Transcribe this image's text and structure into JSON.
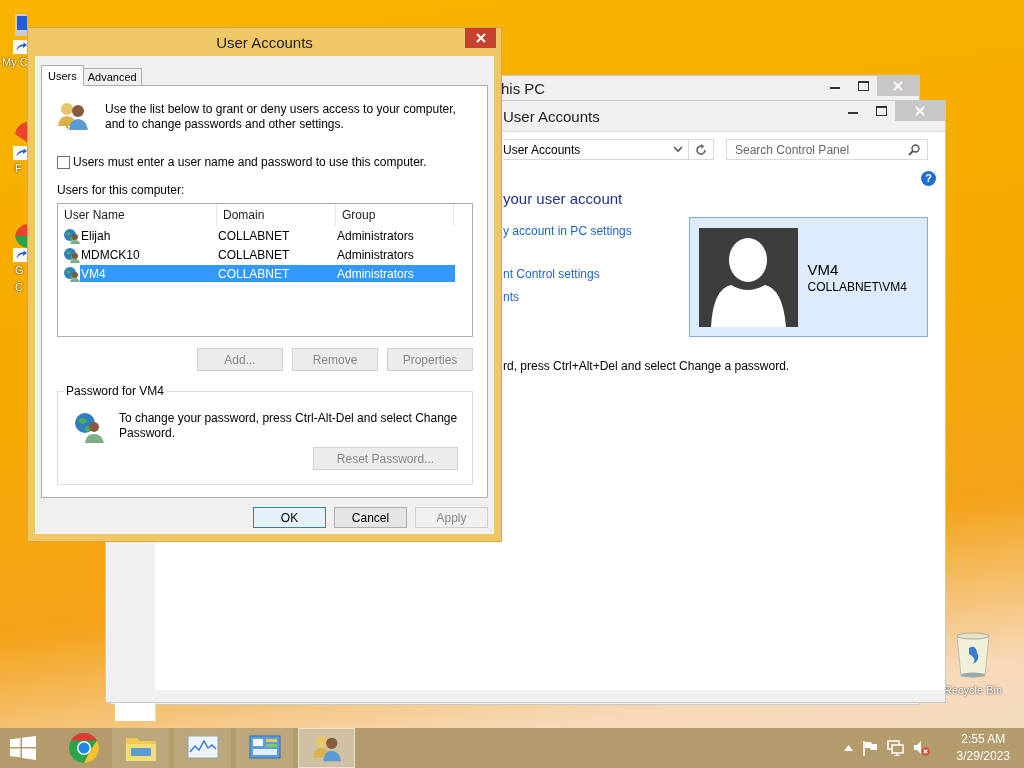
{
  "desktop": {
    "icons": [
      {
        "label": "My C",
        "kind": "computer"
      },
      {
        "label": "F",
        "kind": "red"
      },
      {
        "label": "G C",
        "kind": "green"
      }
    ],
    "recycle_bin": {
      "label": "Recycle Bin"
    }
  },
  "this_pc_window": {
    "title": "his PC"
  },
  "control_panel_window": {
    "title": "User Accounts",
    "address": "User Accounts",
    "search": {
      "placeholder": "Search Control Panel"
    },
    "help": "?",
    "heading": "your user account",
    "links": [
      "y account in PC settings",
      "nt Control settings",
      "nts"
    ],
    "account_card": {
      "name": "VM4",
      "account": "COLLABNET\\VM4"
    },
    "note": "rd, press Ctrl+Alt+Del and select Change a password."
  },
  "dialog": {
    "title": "User Accounts",
    "tabs": [
      {
        "label": "Users",
        "selected": true
      },
      {
        "label": "Advanced",
        "selected": false
      }
    ],
    "intro": "Use the list below to grant or deny users access to your computer, and to change passwords and other settings.",
    "require_password": {
      "label": "Users must enter a user name and password to use this computer.",
      "checked": false
    },
    "list_label": "Users for this computer:",
    "columns": [
      "User Name",
      "Domain",
      "Group"
    ],
    "rows": [
      {
        "user_name": "Elijah",
        "domain": "COLLABNET",
        "group": "Administrators",
        "selected": false
      },
      {
        "user_name": "MDMCK10",
        "domain": "COLLABNET",
        "group": "Administrators",
        "selected": false
      },
      {
        "user_name": "VM4",
        "domain": "COLLABNET",
        "group": "Administrators",
        "selected": true
      }
    ],
    "list_buttons": [
      {
        "label": "Add...",
        "disabled": true
      },
      {
        "label": "Remove",
        "disabled": true
      },
      {
        "label": "Properties",
        "disabled": true
      }
    ],
    "password_group": {
      "title": "Password for VM4",
      "text": "To change your password, press Ctrl-Alt-Del and select Change Password.",
      "button": {
        "label": "Reset Password...",
        "disabled": true
      }
    },
    "buttons": [
      {
        "label": "OK",
        "disabled": false
      },
      {
        "label": "Cancel",
        "disabled": false
      },
      {
        "label": "Apply",
        "disabled": true
      }
    ]
  },
  "taskbar": {
    "items": [
      {
        "kind": "start",
        "selected": false
      },
      {
        "kind": "browser",
        "selected": false
      },
      {
        "kind": "folder",
        "selected": false
      },
      {
        "kind": "monitor",
        "selected": false
      },
      {
        "kind": "control",
        "selected": false
      },
      {
        "kind": "users",
        "selected": true
      }
    ],
    "clock": {
      "time": "2:55 AM",
      "date": "3/29/2023"
    }
  }
}
